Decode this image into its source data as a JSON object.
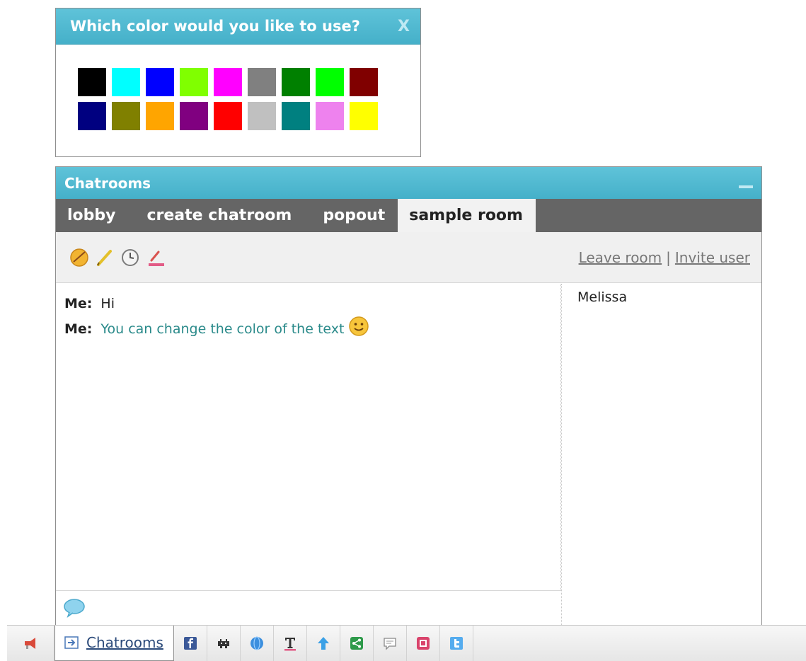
{
  "color_picker": {
    "title": "Which color would you like to use?",
    "close_label": "X",
    "colors": [
      "#000000",
      "#00FFFF",
      "#0000FF",
      "#80FF00",
      "#FF00FF",
      "#808080",
      "#008000",
      "#00FF00",
      "#800000",
      "#000080",
      "#808000",
      "#FFA500",
      "#800080",
      "#FF0000",
      "#C0C0C0",
      "#008080",
      "#EE82EE",
      "#FFFF00"
    ]
  },
  "chatrooms": {
    "title": "Chatrooms",
    "tabs": [
      {
        "label": "lobby"
      },
      {
        "label": "create chatroom"
      },
      {
        "label": "popout"
      },
      {
        "label": "sample room"
      }
    ],
    "links": {
      "leave": "Leave room",
      "separator": "|",
      "invite": "Invite user"
    },
    "messages": [
      {
        "sender": "Me:",
        "text": "Hi"
      },
      {
        "sender": "Me:",
        "text": "You can change the color of the text"
      }
    ],
    "users": [
      "Melissa"
    ]
  },
  "bottom_bar": {
    "chatrooms_label": "Chatrooms"
  }
}
